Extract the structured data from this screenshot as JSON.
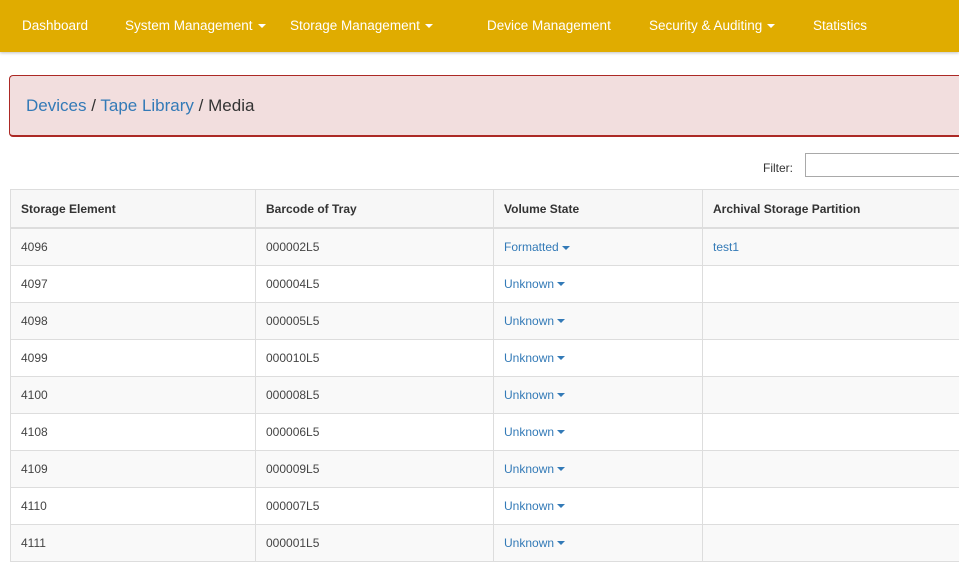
{
  "nav": {
    "items": [
      {
        "label": "Dashboard",
        "has_dropdown": false
      },
      {
        "label": "System Management",
        "has_dropdown": true
      },
      {
        "label": "Storage Management",
        "has_dropdown": true
      },
      {
        "label": "Device Management",
        "has_dropdown": false
      },
      {
        "label": "Security & Auditing",
        "has_dropdown": true
      },
      {
        "label": "Statistics",
        "has_dropdown": false
      }
    ],
    "bg_color": "#e0ac00"
  },
  "breadcrumb": {
    "devices": "Devices",
    "tape_library": "Tape Library",
    "current": "Media",
    "separator": "/"
  },
  "filter": {
    "label": "Filter:",
    "value": ""
  },
  "table": {
    "headers": [
      "Storage Element",
      "Barcode of Tray",
      "Volume State",
      "Archival Storage Partition"
    ],
    "rows": [
      {
        "element": "4096",
        "barcode": "000002L5",
        "state": "Formatted",
        "partition": "test1"
      },
      {
        "element": "4097",
        "barcode": "000004L5",
        "state": "Unknown",
        "partition": ""
      },
      {
        "element": "4098",
        "barcode": "000005L5",
        "state": "Unknown",
        "partition": ""
      },
      {
        "element": "4099",
        "barcode": "000010L5",
        "state": "Unknown",
        "partition": ""
      },
      {
        "element": "4100",
        "barcode": "000008L5",
        "state": "Unknown",
        "partition": ""
      },
      {
        "element": "4108",
        "barcode": "000006L5",
        "state": "Unknown",
        "partition": ""
      },
      {
        "element": "4109",
        "barcode": "000009L5",
        "state": "Unknown",
        "partition": ""
      },
      {
        "element": "4110",
        "barcode": "000007L5",
        "state": "Unknown",
        "partition": ""
      },
      {
        "element": "4111",
        "barcode": "000001L5",
        "state": "Unknown",
        "partition": ""
      }
    ]
  },
  "colors": {
    "link": "#337ab7",
    "alert_bg": "#f2dede",
    "alert_border": "#ac2925"
  }
}
